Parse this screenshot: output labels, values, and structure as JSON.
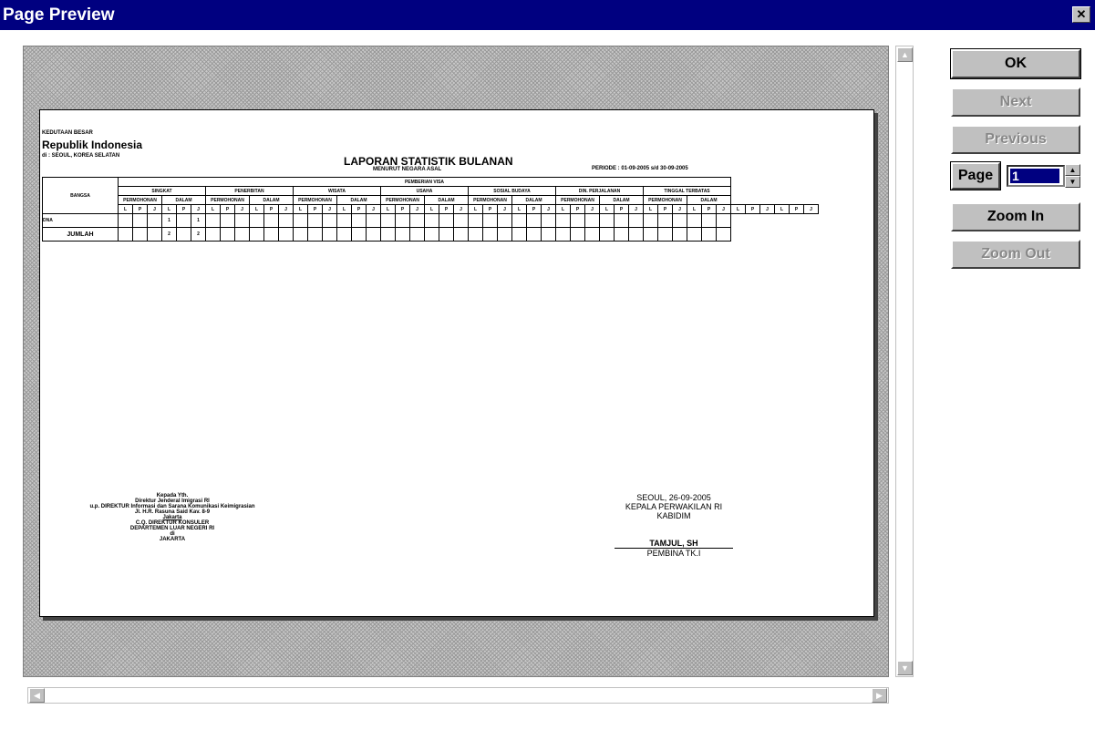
{
  "window": {
    "title": "Page Preview",
    "close_glyph": "✕"
  },
  "buttons": {
    "ok": "OK",
    "next": "Next",
    "previous": "Previous",
    "page": "Page",
    "zoom_in": "Zoom In",
    "zoom_out": "Zoom Out"
  },
  "page_number": "1",
  "report": {
    "org_line1": "KEDUTAAN BESAR",
    "org_line2": "Republik Indonesia",
    "org_line3": "di : SEOUL, KOREA SELATAN",
    "title": "LAPORAN STATISTIK BULANAN",
    "subtitle": "MENURUT NEGARA ASAL",
    "period": "PERIODE : 01-09-2005 s/d 30-09-2005",
    "group_header": "PEMBERIAN VISA",
    "col_bangsa": "BANGSA",
    "categories": [
      "SINGKAT",
      "PENERBITAN",
      "WISATA",
      "USAHA",
      "SOSIAL BUDAYA",
      "DIN. PERJALANAN",
      "TINGGAL TERBATAS"
    ],
    "sub_a": "PERMOHONAN",
    "sub_b": "DALAM",
    "lpj": [
      "L",
      "P",
      "J"
    ],
    "row1_label": "DNA",
    "row1_values": [
      "1",
      "1"
    ],
    "total_label": "JUMLAH",
    "total_values": [
      "2",
      "2"
    ],
    "left_sig": [
      "Kepada Yth.",
      "Direktur Jenderal Imigrasi RI",
      "u.p. DIREKTUR Informasi dan Sarana Komunikasi Keimigrasian",
      "Jl. H.R. Rasuna Said Kav. 8-9",
      "Jakarta",
      "C.Q. DIREKTUR KONSULER",
      "DEPARTEMEN LUAR NEGERI RI",
      "di",
      "JAKARTA"
    ],
    "right_sig_place_date": "SEOUL, 26-09-2005",
    "right_sig_title": "KEPALA PERWAKILAN RI",
    "right_sig_role": "KABIDIM",
    "right_sig_name": "TAMJUL, SH",
    "right_sig_rank": "PEMBINA TK.I"
  },
  "colors": {
    "titlebar": "#000080",
    "button_face": "#c0c0c0",
    "preview_bg": "#c8c8c8"
  }
}
